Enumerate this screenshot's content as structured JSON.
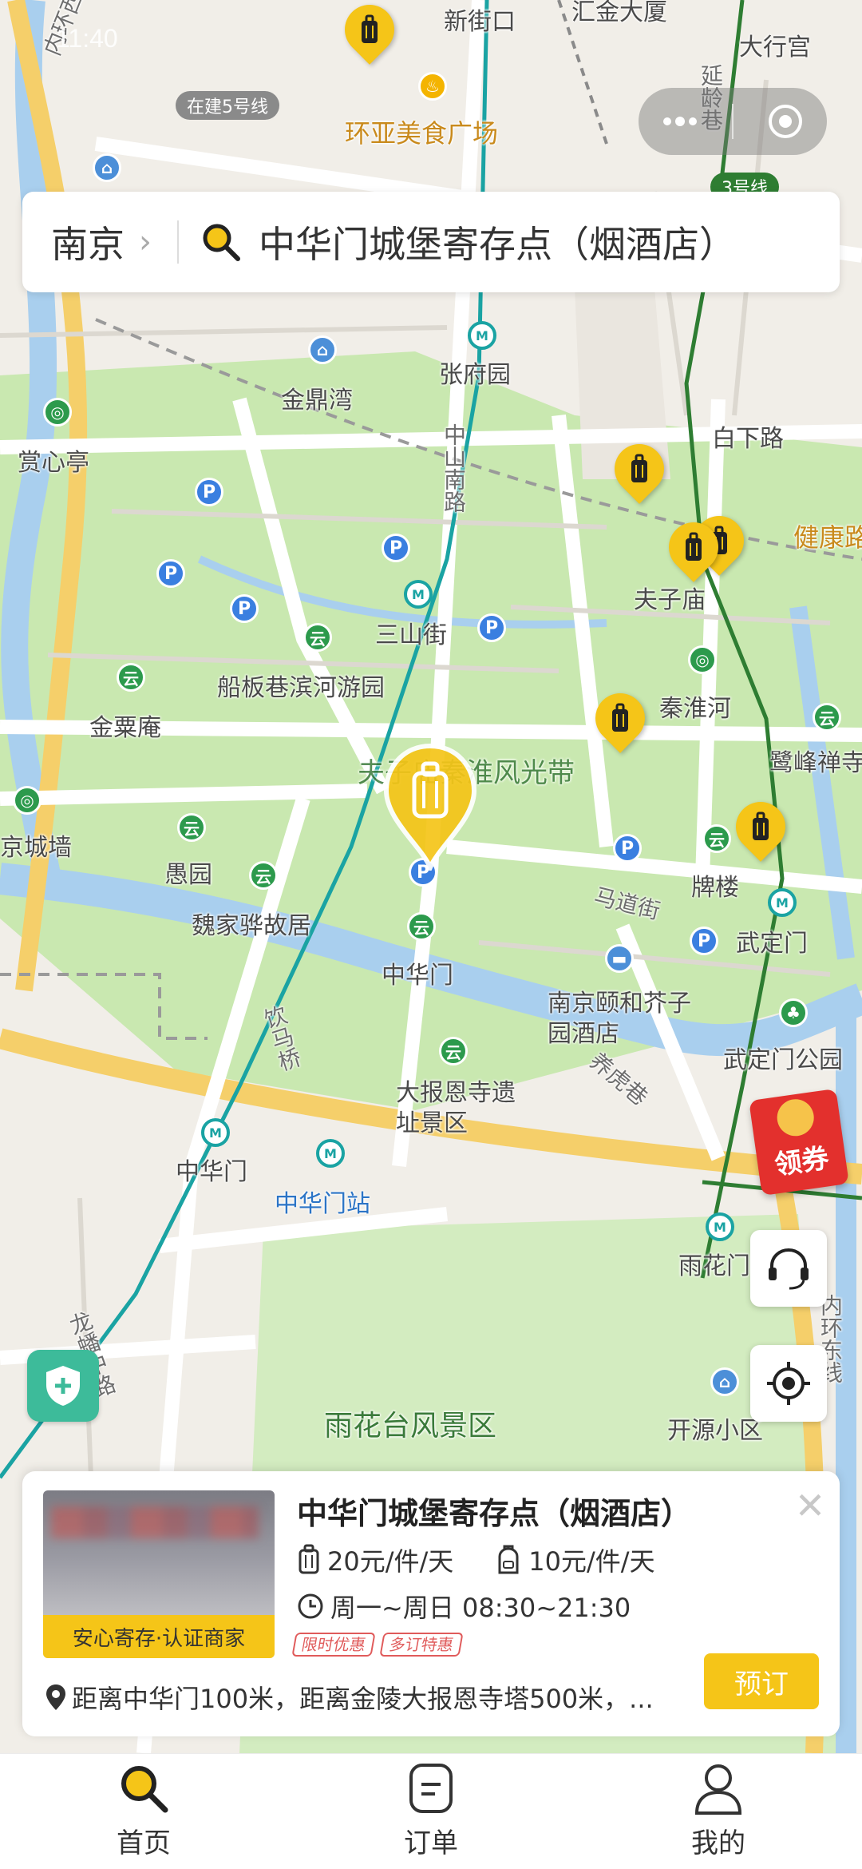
{
  "status_bar": {
    "time": "11:40"
  },
  "search": {
    "city": "南京",
    "query": "中华门城堡寄存点（烟酒店）"
  },
  "map": {
    "labels": [
      "新街口",
      "汇金大厦",
      "大行宫",
      "在建5号线",
      "环亚美食广场",
      "延龄巷",
      "3号线",
      "内环西线",
      "张府园",
      "金鼎湾",
      "白下路",
      "健康路",
      "赏心亭",
      "中山南路",
      "夫子庙",
      "三山街",
      "船板巷滨河游园",
      "秦淮河",
      "金粟庵",
      "鹭峰禅寺",
      "夫子庙秦淮风光带",
      "京城墙",
      "愚园",
      "马道街",
      "牌楼",
      "魏家骅故居",
      "武定门",
      "中华门",
      "南京颐和芥子园酒店",
      "武定门公园",
      "饮马桥",
      "大报恩寺遗址景区",
      "养虎巷",
      "中华门",
      "中华门站",
      "雨花门",
      "雨花台风景区",
      "开源小区",
      "龙蟠中路",
      "内环东线"
    ]
  },
  "coupon": {
    "label": "领券"
  },
  "store_card": {
    "title": "中华门城堡寄存点（烟酒店）",
    "badge": "安心寄存·认证商家",
    "price_luggage": "20元/件/天",
    "price_bag": "10元/件/天",
    "hours": "周一~周日 08:30~21:30",
    "tags": [
      "限时优惠",
      "多订特惠"
    ],
    "distance": "距离中华门100米，距离金陵大报恩寺塔500米，...",
    "reserve_label": "预订"
  },
  "tabs": [
    {
      "label": "首页",
      "icon": "search-icon",
      "active": true
    },
    {
      "label": "订单",
      "icon": "order-icon",
      "active": false
    },
    {
      "label": "我的",
      "icon": "profile-icon",
      "active": false
    }
  ],
  "colors": {
    "accent": "#f5c518",
    "park": "#c9e8b0",
    "river": "#a9cfee",
    "metro": "#1aa3a3"
  }
}
